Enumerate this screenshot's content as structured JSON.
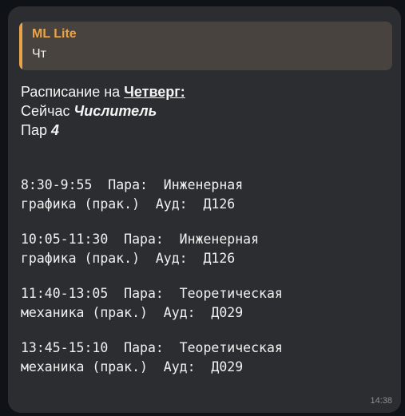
{
  "reply": {
    "sender": "ML Lite",
    "text": "Чт"
  },
  "header": {
    "schedule_prefix": "Расписание на ",
    "day": "Четверг:",
    "now_prefix": "Сейчас ",
    "week_type": "Числитель",
    "count_prefix": "Пар ",
    "count": "4"
  },
  "lessons": [
    {
      "line1": "8:30-9:55  Пара:  Инженерная",
      "line2": "графика (прак.)  Ауд:  Д126"
    },
    {
      "line1": "10:05-11:30  Пара:  Инженерная",
      "line2": "графика (прак.)  Ауд:  Д126"
    },
    {
      "line1": "11:40-13:05  Пара:  Теоретическая",
      "line2": "механика (прак.)  Ауд:  Д029"
    },
    {
      "line1": "13:45-15:10  Пара:  Теоретическая",
      "line2": "механика (прак.)  Ауд:  Д029"
    }
  ],
  "time": "14:38",
  "colors": {
    "background": "#0f1216",
    "bubble": "#2b2d30",
    "reply_background": "#48433f",
    "accent": "#e8a447",
    "text": "#f1f1f1",
    "timestamp": "#8c8f93"
  }
}
